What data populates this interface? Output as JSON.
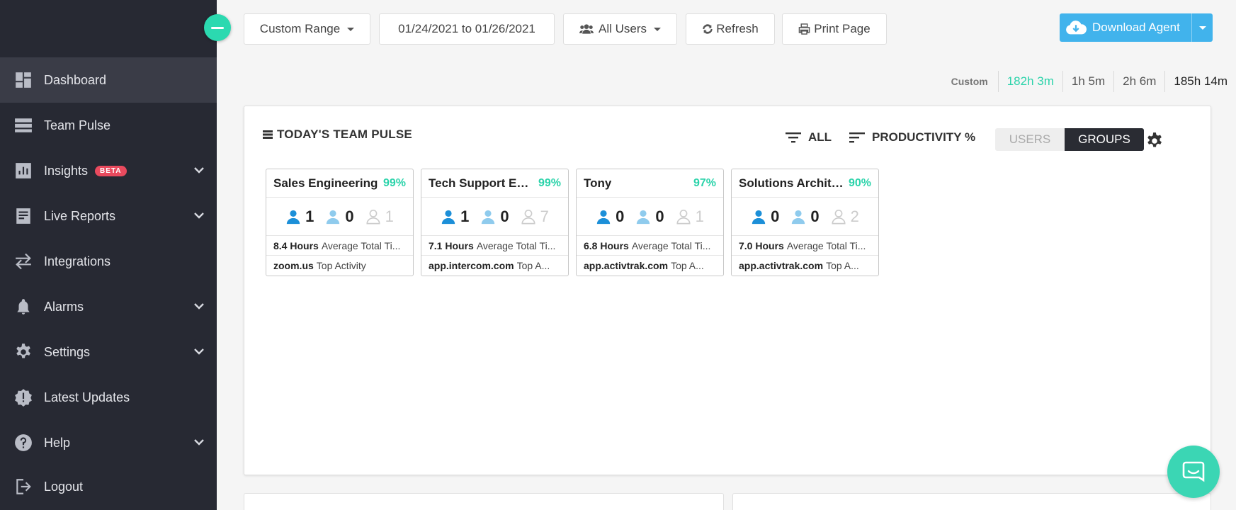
{
  "sidebar": {
    "items": [
      {
        "label": "Dashboard",
        "icon": "dashboard-icon",
        "active": true
      },
      {
        "label": "Team Pulse",
        "icon": "team-pulse-icon"
      },
      {
        "label": "Insights",
        "icon": "insights-icon",
        "badge": "BETA",
        "expandable": true
      },
      {
        "label": "Live Reports",
        "icon": "live-reports-icon",
        "expandable": true
      },
      {
        "label": "Integrations",
        "icon": "integrations-icon"
      },
      {
        "label": "Alarms",
        "icon": "bell-icon",
        "expandable": true
      },
      {
        "label": "Settings",
        "icon": "gear-icon",
        "expandable": true
      },
      {
        "label": "Latest Updates",
        "icon": "alert-badge-icon"
      },
      {
        "label": "Help",
        "icon": "help-icon",
        "expandable": true
      },
      {
        "label": "Logout",
        "icon": "logout-icon"
      }
    ]
  },
  "toolbar": {
    "range_label": "Custom Range",
    "date_range": "01/24/2021 to 01/26/2021",
    "users_label": "All Users",
    "refresh_label": "Refresh",
    "print_label": "Print Page",
    "download_label": "Download Agent"
  },
  "time_summary": {
    "label": "Custom",
    "values": [
      "182h 3m",
      "1h 5m",
      "2h 6m",
      "185h 14m"
    ]
  },
  "team_pulse": {
    "title": "TODAY'S TEAM PULSE",
    "filter_label": "ALL",
    "sort_label": "PRODUCTIVITY %",
    "toggle": {
      "users": "USERS",
      "groups": "GROUPS",
      "selected": "GROUPS"
    },
    "cards": [
      {
        "name": "Sales Engineering",
        "pct": "99%",
        "active": "1",
        "passive": "0",
        "inactive": "1",
        "hours": "8.4 Hours",
        "hours_text": "Average Total Ti...",
        "top": "zoom.us",
        "top_text": "Top Activity"
      },
      {
        "name": "Tech Support Eng...",
        "pct": "99%",
        "active": "1",
        "passive": "0",
        "inactive": "7",
        "hours": "7.1 Hours",
        "hours_text": "Average Total Ti...",
        "top": "app.intercom.com",
        "top_text": "Top A..."
      },
      {
        "name": "Tony",
        "pct": "97%",
        "active": "0",
        "passive": "0",
        "inactive": "1",
        "hours": "6.8 Hours",
        "hours_text": "Average Total Ti...",
        "top": "app.activtrak.com",
        "top_text": "Top A..."
      },
      {
        "name": "Solutions Archite...",
        "pct": "90%",
        "active": "0",
        "passive": "0",
        "inactive": "2",
        "hours": "7.0 Hours",
        "hours_text": "Average Total Ti...",
        "top": "app.activtrak.com",
        "top_text": "Top A..."
      }
    ]
  },
  "colors": {
    "accent": "#2bd3aa",
    "download": "#41b3ec",
    "sidebar": "#272933",
    "beta": "#e94a5e"
  }
}
